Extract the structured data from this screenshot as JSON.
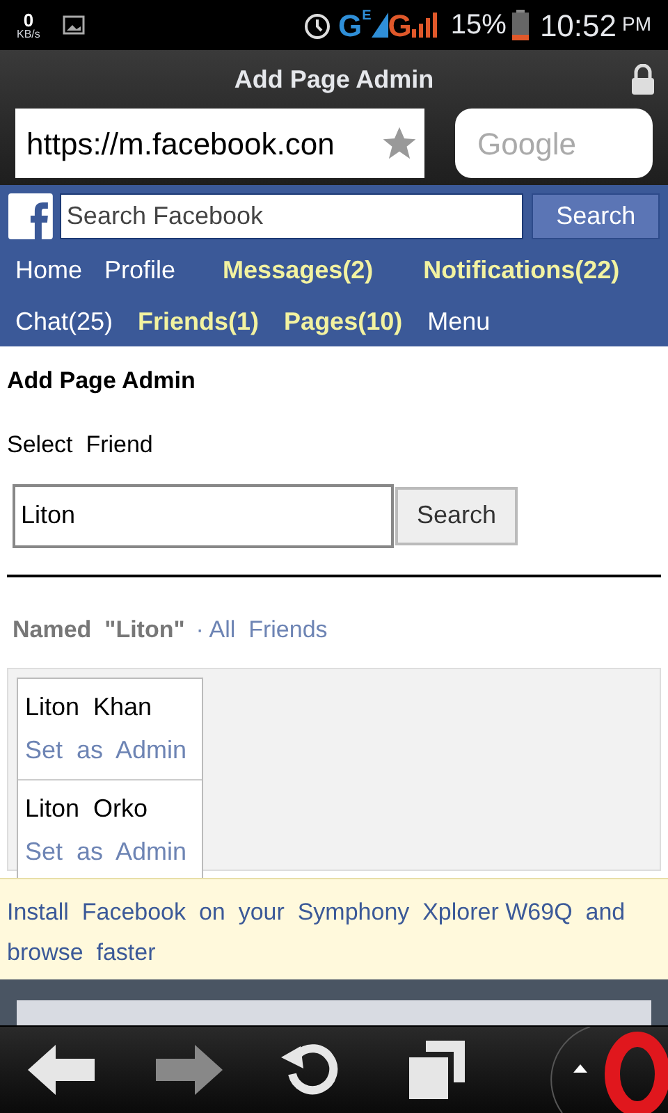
{
  "status_bar": {
    "speed_value": "0",
    "speed_unit": "KB/s",
    "network_1": "G",
    "network_1_sup": "E",
    "network_2": "G",
    "battery": "15%",
    "time": "10:52",
    "ampm": "PM"
  },
  "browser": {
    "title": "Add Page Admin",
    "url": "https://m.facebook.con",
    "search_placeholder": "Google"
  },
  "facebook_header": {
    "search_placeholder": "Search Facebook",
    "search_button": "Search",
    "nav": [
      {
        "label": "Home",
        "highlighted": false
      },
      {
        "label": "Profile",
        "highlighted": false
      },
      {
        "label": "Messages(2)",
        "highlighted": true
      },
      {
        "label": "Notifications(22)",
        "highlighted": true
      },
      {
        "label": "Chat(25)",
        "highlighted": false
      },
      {
        "label": "Friends(1)",
        "highlighted": true
      },
      {
        "label": "Pages(10)",
        "highlighted": true
      },
      {
        "label": "Menu",
        "highlighted": false
      }
    ]
  },
  "page": {
    "heading": "Add Page Admin",
    "subheading": "Select  Friend",
    "search_value": "Liton",
    "search_button": "Search",
    "filter_label": "Named  \"Liton\"",
    "filter_link": "· All  Friends",
    "results": [
      {
        "name": "Liton  Khan",
        "action": "Set  as  Admin"
      },
      {
        "name": "Liton  Orko",
        "action": "Set  as  Admin"
      }
    ]
  },
  "banner": {
    "text": "Install  Facebook  on  your  Symphony  Xplorer W69Q  and  browse  faster"
  }
}
